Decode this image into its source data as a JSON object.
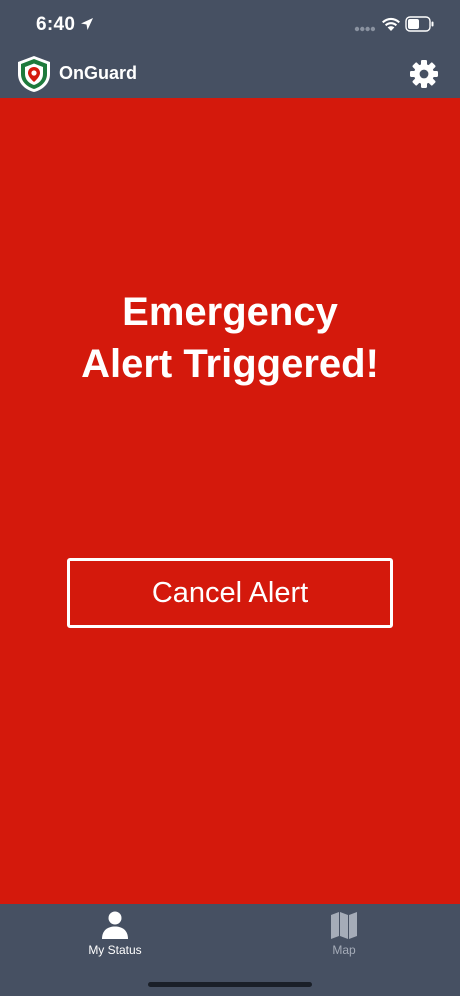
{
  "status_bar": {
    "time": "6:40",
    "location_icon": "location-arrow-icon",
    "signal_icon": "cellular-signal-icon",
    "wifi_icon": "wifi-icon",
    "battery_icon": "battery-icon"
  },
  "header": {
    "app_name": "OnGuard",
    "logo_icon": "onguard-shield-logo",
    "settings_icon": "gear-icon"
  },
  "alert": {
    "title_line1": "Emergency",
    "title_line2": "Alert Triggered!",
    "cancel_label": "Cancel Alert"
  },
  "tab_bar": {
    "tabs": [
      {
        "label": "My Status",
        "icon": "person-icon",
        "active": true
      },
      {
        "label": "Map",
        "icon": "map-icon",
        "active": false
      }
    ]
  },
  "colors": {
    "header_bg": "#465062",
    "alert_bg": "#d4190c",
    "text": "#ffffff",
    "tab_inactive": "#a5acb8",
    "logo_green": "#1e7a3c",
    "logo_red": "#d4190c"
  }
}
